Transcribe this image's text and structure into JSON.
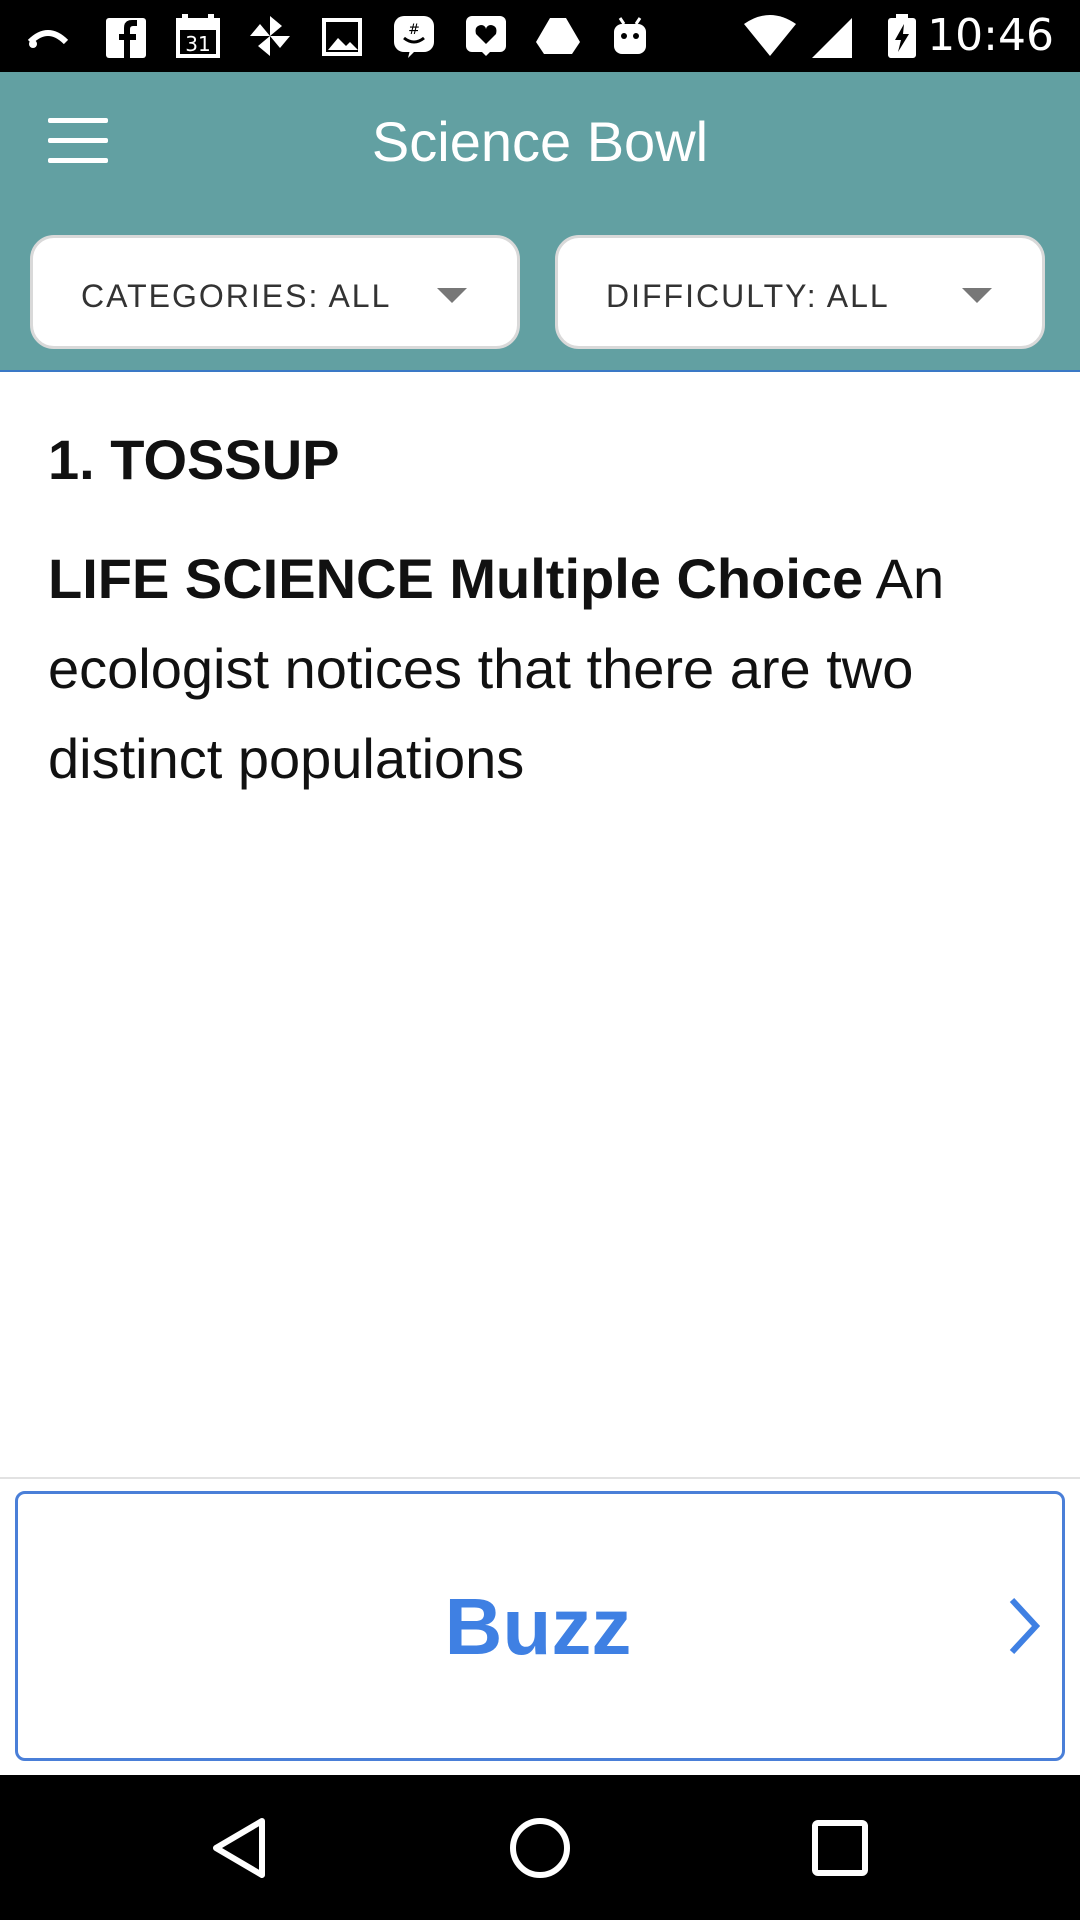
{
  "status_bar": {
    "time": "10:46",
    "icons": [
      "cast-icon",
      "facebook-icon",
      "calendar-icon",
      "pinwheel-icon",
      "photos-icon",
      "groupme-icon",
      "heart-message-icon",
      "drive-icon",
      "android-icon",
      "wifi-icon",
      "signal-icon",
      "battery-charging-icon"
    ],
    "calendar_day": "31"
  },
  "app_bar": {
    "title": "Science Bowl",
    "menu_icon": "hamburger-menu-icon",
    "background": "#62a0a2"
  },
  "filters": {
    "categories_label": "CATEGORIES: ALL",
    "difficulty_label": "DIFFICULTY: ALL"
  },
  "question": {
    "number_label": "1. TOSSUP",
    "category": "LIFE SCIENCE Multiple Choice",
    "text": " An ecologist notices that there are two distinct populations"
  },
  "buzz_button": {
    "label": "Buzz",
    "color": "#3f80e3",
    "icon": "chevron-right-icon"
  },
  "nav_bar": {
    "icons": [
      "back-icon",
      "home-icon",
      "recents-icon"
    ]
  }
}
